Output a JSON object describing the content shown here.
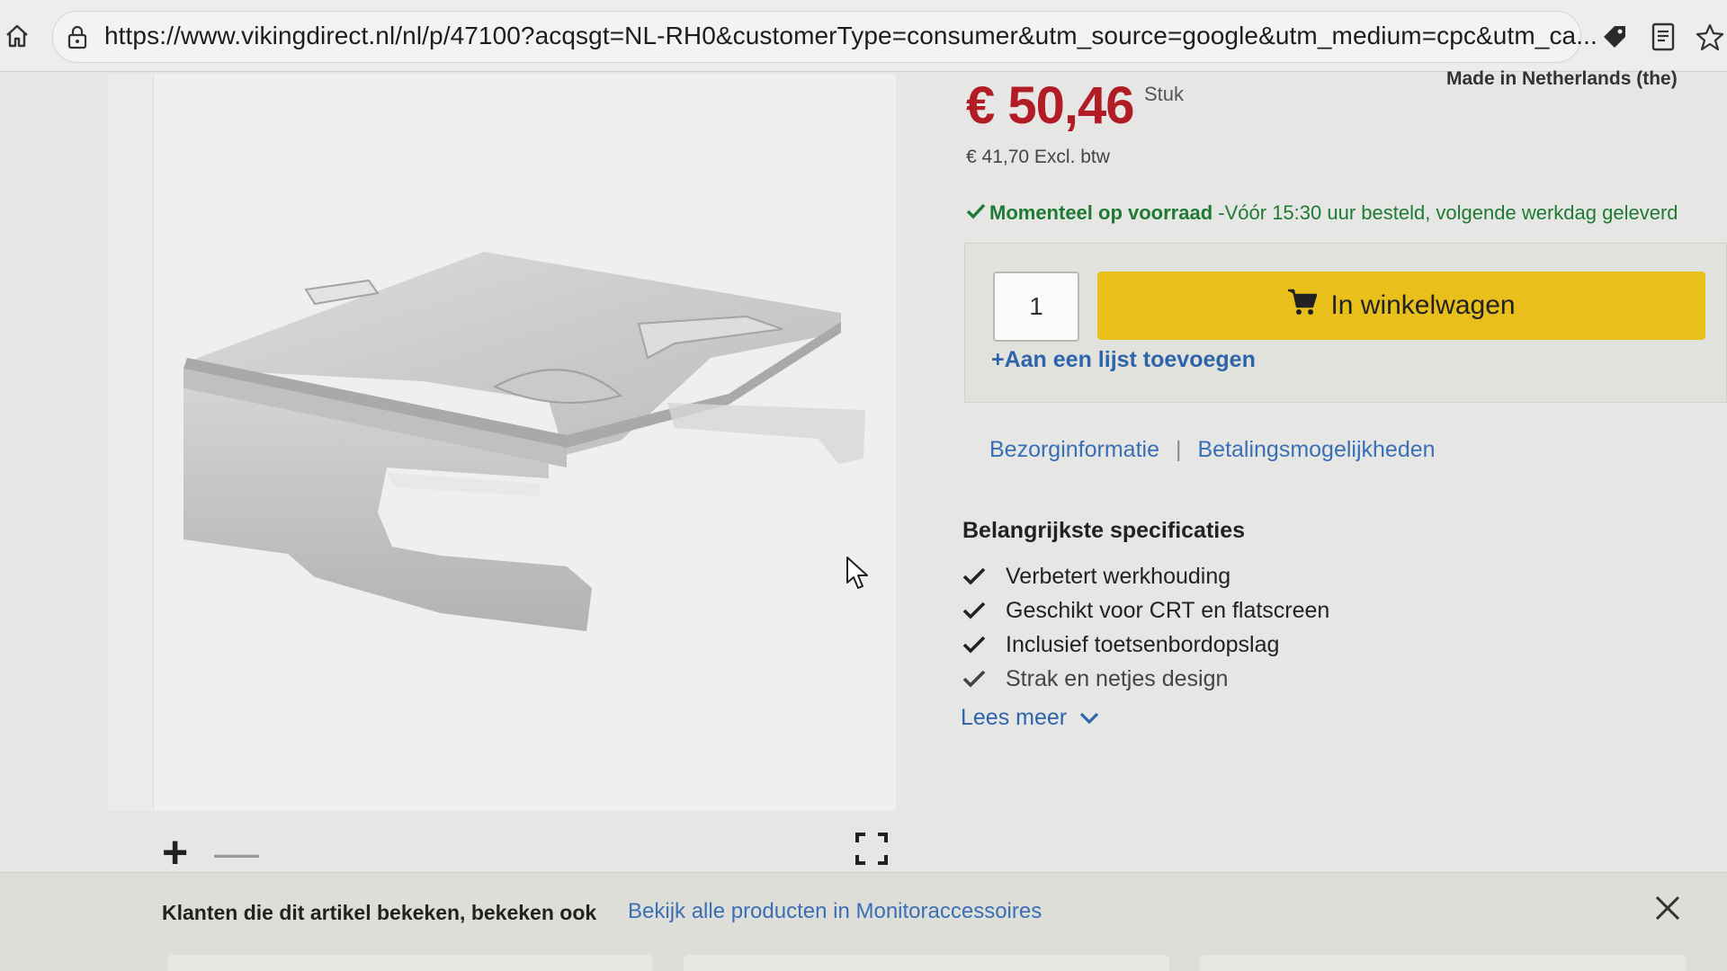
{
  "browser": {
    "url": "https://www.vikingdirect.nl/nl/p/47100?acqsgt=NL-RH0&customerType=consumer&utm_source=google&utm_medium=cpc&utm_ca..."
  },
  "product": {
    "price": "€ 50,46",
    "price_unit": "Stuk",
    "price_excl": "€ 41,70 Excl. btw",
    "origin": "Made in Netherlands (the)",
    "stock_status": "Momenteel op voorraad",
    "delivery_note": "-Vóór 15:30 uur besteld, volgende werkdag geleverd"
  },
  "cart": {
    "quantity": "1",
    "add_button_label": "In winkelwagen",
    "add_to_list_label": "+Aan een lijst toevoegen"
  },
  "info_links": {
    "delivery": "Bezorginformatie",
    "separator": "|",
    "payment": "Betalingsmogelijkheden"
  },
  "specs": {
    "title": "Belangrijkste specificaties",
    "items": [
      "Verbetert werkhouding",
      "Geschikt voor CRT en flatscreen",
      "Inclusief toetsenbordopslag",
      "Strak en netjes design"
    ],
    "read_more": "Lees meer"
  },
  "gallery": {
    "zoom_in": "+",
    "zoom_out": "—"
  },
  "banner": {
    "title": "Klanten die dit artikel bekeken, bekeken ook",
    "link": "Bekijk alle producten in Monitoraccessoires"
  },
  "colors": {
    "price": "#b21c25",
    "stock": "#1e7a32",
    "cart_button": "#e9bf1c",
    "link": "#2d64ac"
  },
  "icons": {
    "home": "home-icon",
    "lock": "lock-icon",
    "extension": "tag-icon",
    "reader": "reader-icon",
    "bookmark": "star-icon",
    "cart": "cart-icon",
    "check": "check-icon",
    "fullscreen": "fullscreen-icon",
    "close": "close-icon",
    "chevron": "chevron-down-icon"
  }
}
